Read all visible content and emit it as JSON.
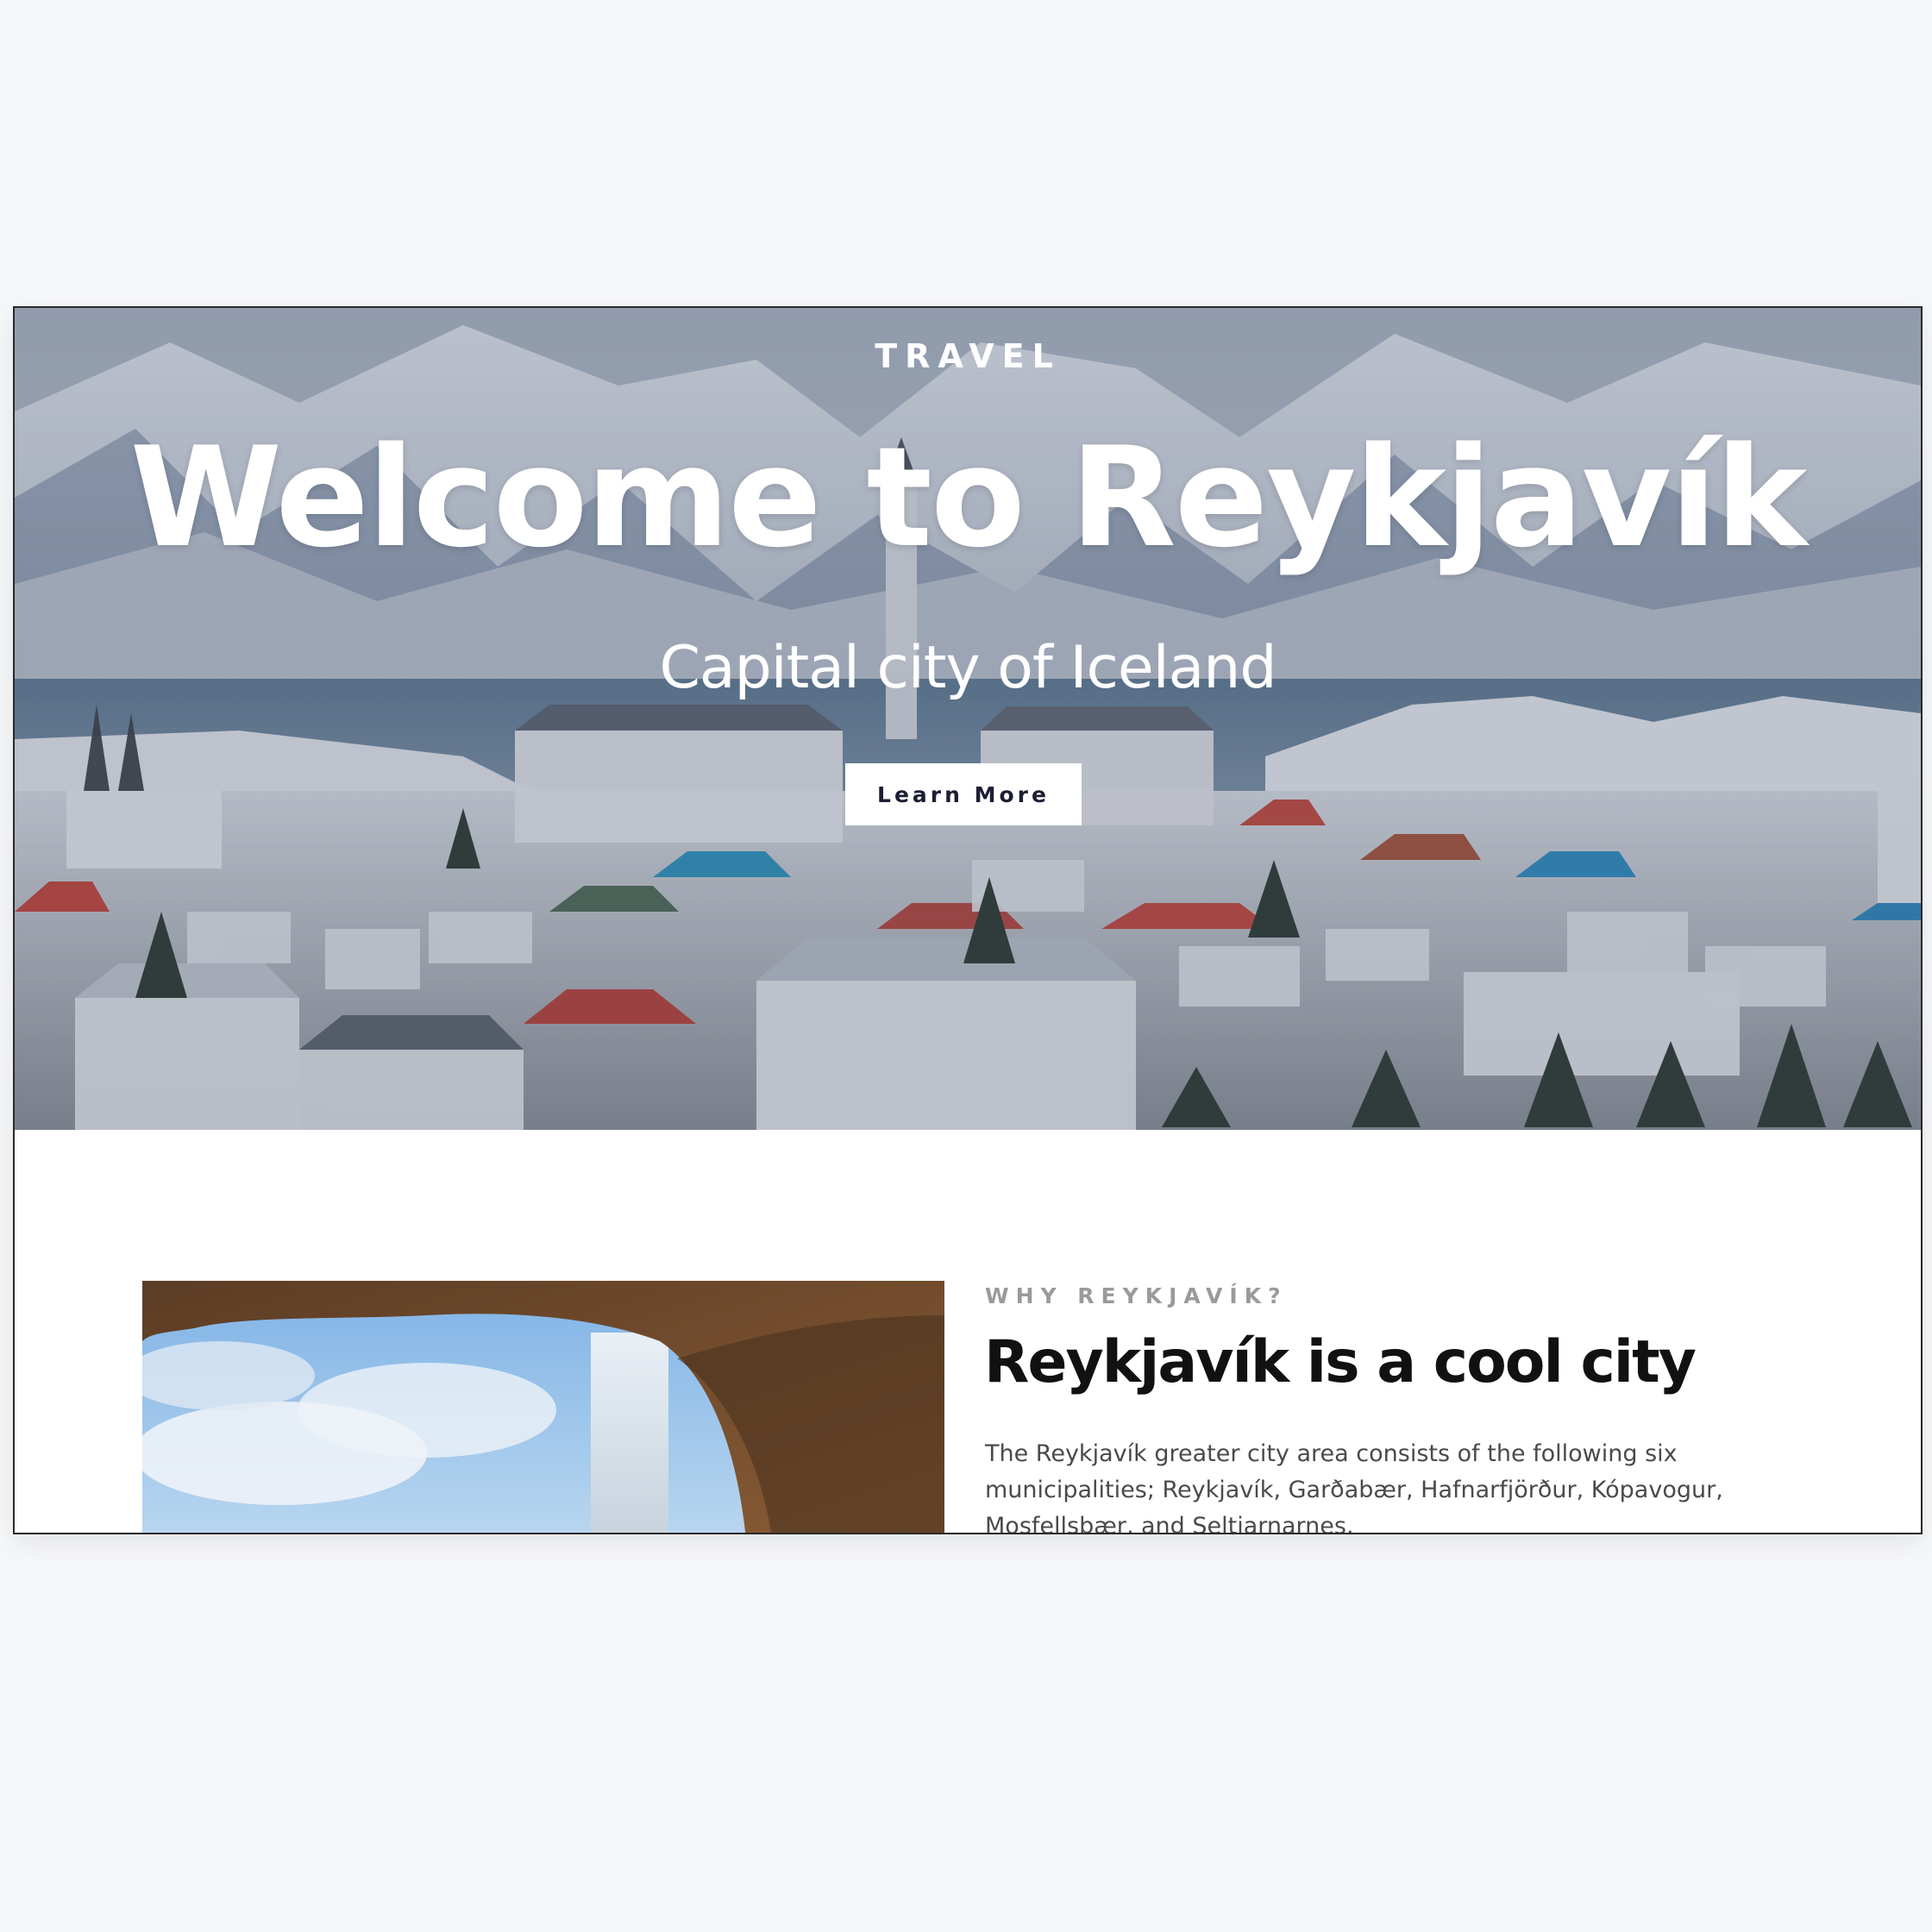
{
  "hero": {
    "eyebrow": "TRAVEL",
    "title": "Welcome to Reykjavík",
    "subtitle": "Capital city of Iceland",
    "cta_label": "Learn More"
  },
  "article": {
    "kicker": "WHY REYKJAVÍK?",
    "headline": "Reykjavík is a cool city",
    "body": "The Reykjavík greater city area consists of the following six municipalities; Reykjavík, Garðabær, Hafnarfjörður, Kópavogur, Mosfellsbær, and Seltjarnarnes."
  },
  "colors": {
    "page_background": "#f6f7f9",
    "cta_text": "#1d1d35",
    "kicker": "#9a9a9a",
    "headline": "#111111",
    "body_text": "#4a4a4a"
  }
}
